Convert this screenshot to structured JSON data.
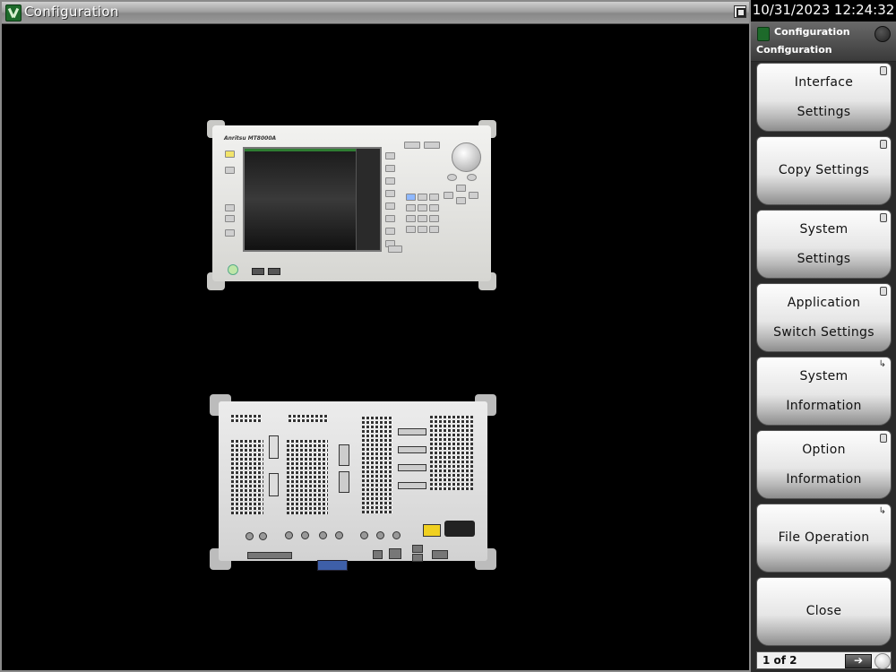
{
  "window": {
    "title": "Configuration",
    "icon": "configuration-icon",
    "maximize_icon": "maximize-icon"
  },
  "clock": {
    "datetime": "10/31/2023 12:24:32"
  },
  "instrument": {
    "front": {
      "brand": "Anritsu MT8000A"
    },
    "rear": {}
  },
  "side_panel": {
    "header_title": "Configuration",
    "header_subtitle": "Configuration",
    "softkeys": [
      {
        "label": "Interface\nSettings",
        "mark": "lock-icon"
      },
      {
        "label": "Copy Settings",
        "mark": "lock-icon"
      },
      {
        "label": "System\nSettings",
        "mark": "lock-icon"
      },
      {
        "label": "Application\nSwitch Settings",
        "mark": "lock-icon"
      },
      {
        "label": "System\nInformation",
        "mark": "submenu-arrow-icon",
        "mark_glyph": "↳"
      },
      {
        "label": "Option\nInformation",
        "mark": "lock-icon"
      },
      {
        "label": "File Operation",
        "mark": "submenu-arrow-icon",
        "mark_glyph": "↳"
      },
      {
        "label": "Close",
        "mark": ""
      }
    ],
    "pager": {
      "text": "1 of 2",
      "next_glyph": "➔"
    }
  }
}
